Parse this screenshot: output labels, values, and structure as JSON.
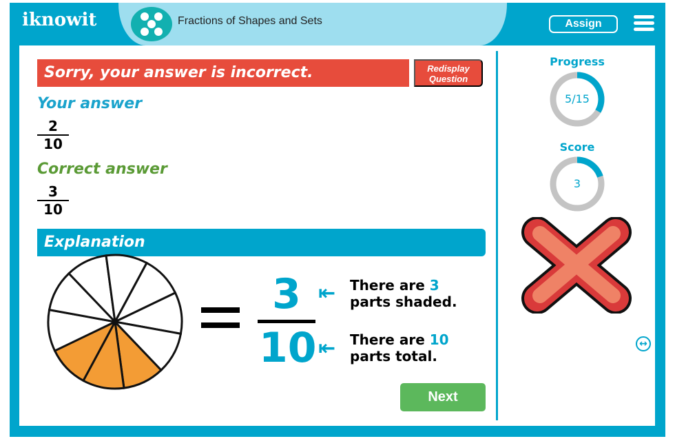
{
  "header": {
    "logo": "iknowit",
    "title": "Fractions of Shapes and Sets",
    "assign_label": "Assign",
    "menu_icon": "hamburger-icon",
    "brand_color": "#00a5cc"
  },
  "feedback": {
    "message": "Sorry, your answer is incorrect.",
    "redisplay_label": "Redisplay Question"
  },
  "your_answer": {
    "label": "Your answer",
    "numerator": "2",
    "denominator": "10"
  },
  "correct_answer": {
    "label": "Correct answer",
    "numerator": "3",
    "denominator": "10"
  },
  "explanation": {
    "label": "Explanation",
    "slices_total": 10,
    "slices_shaded": 3,
    "shade_color": "#f39c35",
    "numerator": "3",
    "denominator": "10",
    "note1_pre": "There are ",
    "note1_num": "3",
    "note1_post": "parts shaded.",
    "note2_pre": "There are ",
    "note2_num": "10",
    "note2_post": "parts total."
  },
  "next_label": "Next",
  "sidebar": {
    "progress_label": "Progress",
    "progress_value": "5/15",
    "progress_fraction": 0.333,
    "score_label": "Score",
    "score_value": "3",
    "score_fraction": 0.2,
    "result_icon": "red-x-icon",
    "swap_icon": "swap-arrows-icon"
  }
}
